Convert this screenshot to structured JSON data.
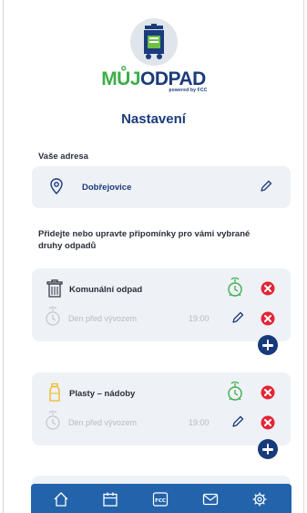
{
  "brand": {
    "part1": "MŮJ",
    "part2": "ODPAD",
    "sub": "powered by FCC"
  },
  "page_title": "Nastavení",
  "address": {
    "label": "Vaše adresa",
    "city": "Dobřejovice"
  },
  "reminders_label": "Přidejte nebo upravte připomínky pro vámi vybrané druhy odpadů",
  "waste_types": [
    {
      "name": "Komunální odpad",
      "icon": "trash-bin-icon",
      "reminder": {
        "text": "Den před vývozem",
        "time": "19:00"
      }
    },
    {
      "name": "Plasty – nádoby",
      "icon": "plastic-bottle-icon",
      "reminder": {
        "text": "Den před vývozem",
        "time": "19:00"
      }
    }
  ],
  "nav": [
    {
      "name": "nav-home",
      "icon": "home-icon"
    },
    {
      "name": "nav-calendar",
      "icon": "calendar-icon"
    },
    {
      "name": "nav-fcc",
      "icon": "fcc-icon",
      "label": "FCC"
    },
    {
      "name": "nav-messages",
      "icon": "envelope-icon"
    },
    {
      "name": "nav-settings",
      "icon": "gear-icon"
    }
  ],
  "colors": {
    "navy": "#1b3b7c",
    "green": "#3fae49",
    "red": "#e52535",
    "card": "#eef1f5",
    "nav": "#2263ab"
  }
}
